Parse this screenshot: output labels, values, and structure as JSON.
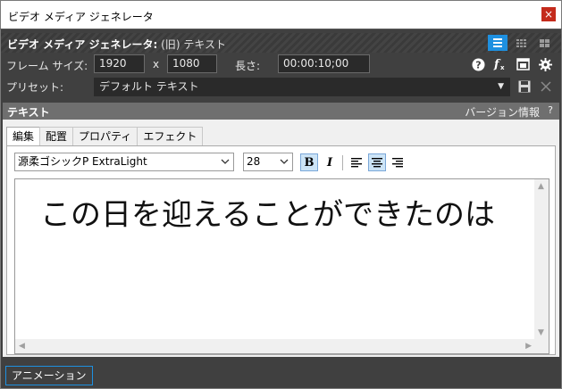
{
  "window": {
    "title": "ビデオ メディア ジェネレータ",
    "close_glyph": "×"
  },
  "header": {
    "generator_name": "ビデオ メディア ジェネレータ:",
    "preset_label_in_title": " (旧) テキスト"
  },
  "frame": {
    "size_label": "フレーム サイズ:",
    "width": "1920",
    "x_sep": "x",
    "height": "1080",
    "length_label": "長さ:",
    "length": "00:00:10;00"
  },
  "preset": {
    "label": "プリセット:",
    "value": "デフォルト テキスト"
  },
  "section": {
    "title": "テキスト",
    "version_info": "バージョン情報",
    "help": "?"
  },
  "tabs": [
    {
      "label": "編集",
      "active": true
    },
    {
      "label": "配置",
      "active": false
    },
    {
      "label": "プロパティ",
      "active": false
    },
    {
      "label": "エフェクト",
      "active": false
    }
  ],
  "toolbar": {
    "font": "源柔ゴシックP ExtraLight",
    "size": "28",
    "bold": "B",
    "italic": "I"
  },
  "editor": {
    "text": "この日を迎えることができたのは"
  },
  "footer": {
    "animation_button": "アニメーション"
  },
  "colors": {
    "accent": "#1e90e0",
    "panel_dark": "#404040",
    "close_red": "#c42b1c"
  }
}
